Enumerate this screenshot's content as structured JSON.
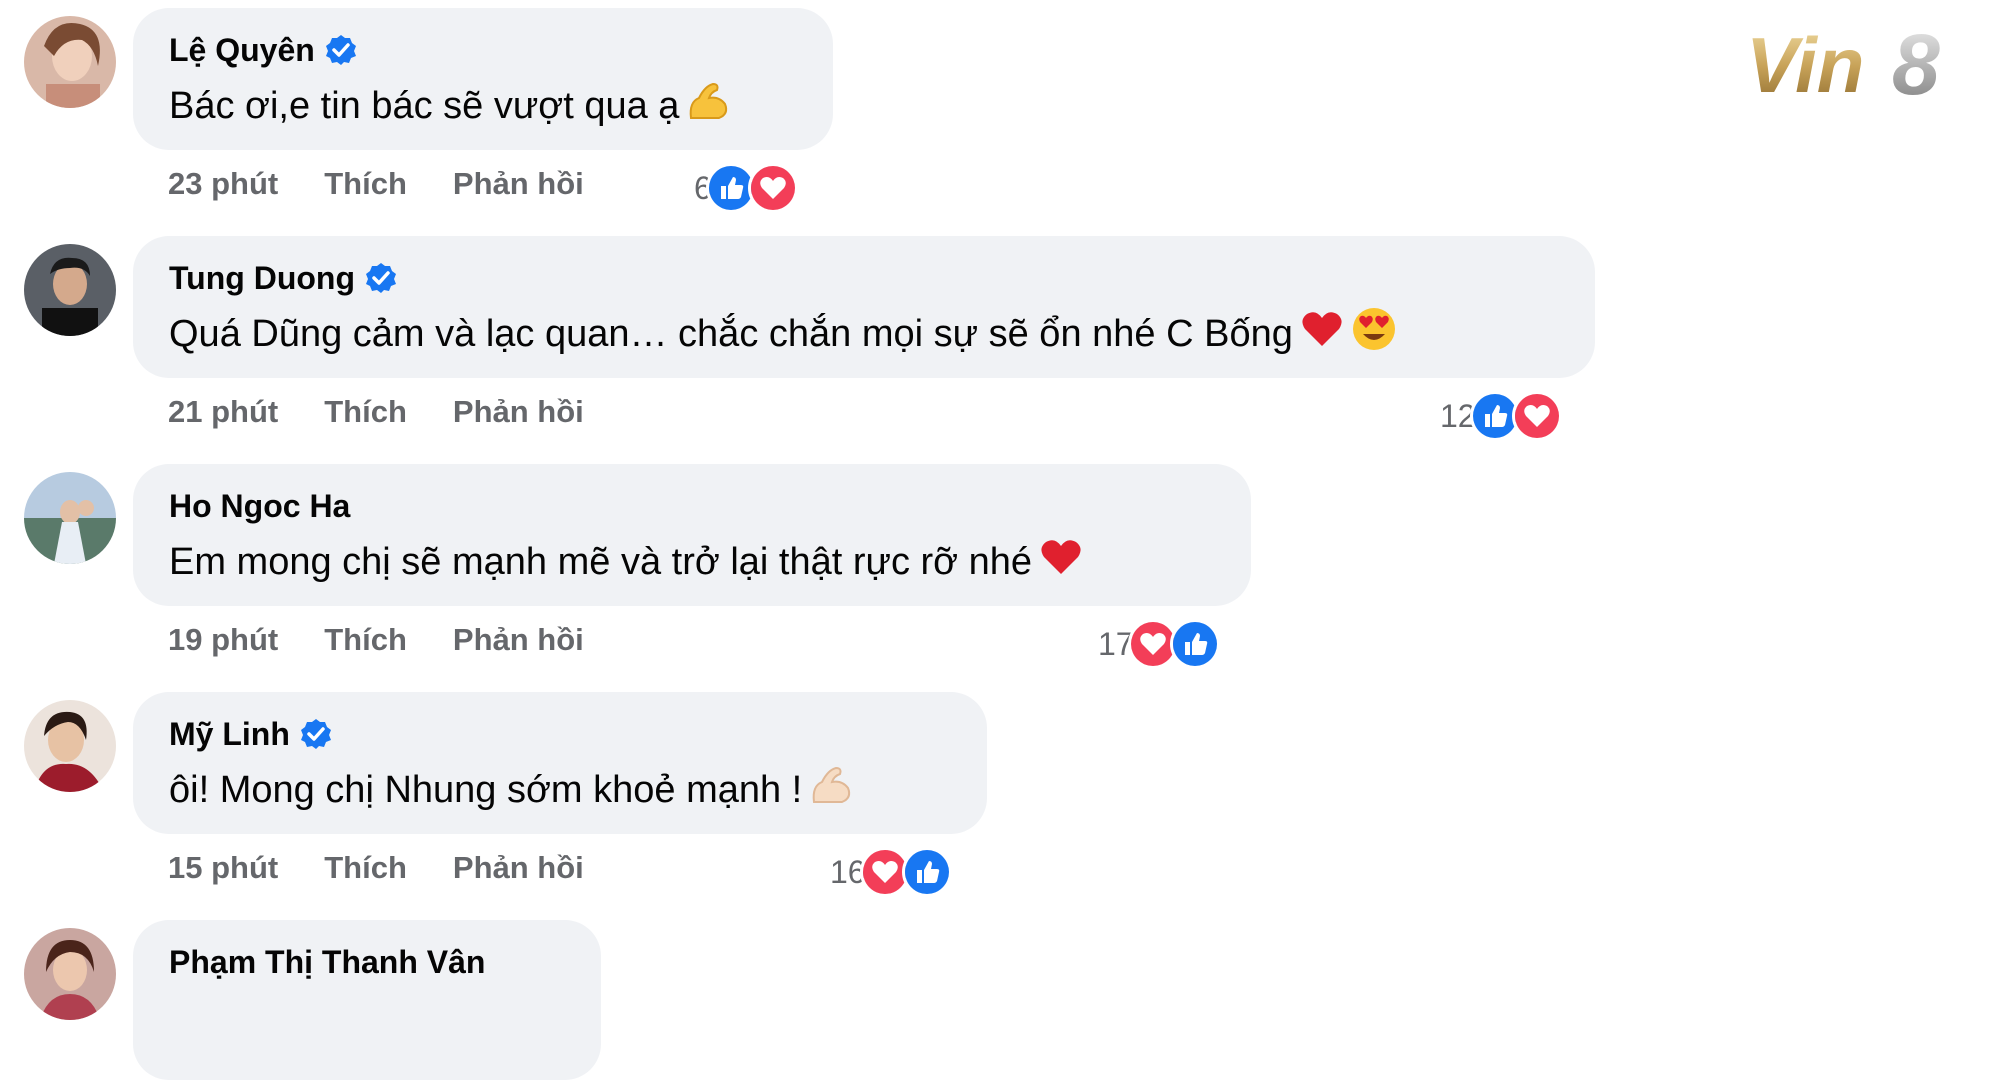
{
  "brand": {
    "logo_text": "Vin8"
  },
  "comments": [
    {
      "name": "Lệ Quyên",
      "verified": true,
      "text": "Bác ơi,e tin bác sẽ vượt qua ạ",
      "emoji": "flexed-biceps",
      "time": "23 phút",
      "like_label": "Thích",
      "reply_label": "Phản hồi",
      "reaction_count": "6",
      "reactions": [
        "like-icon",
        "love-icon"
      ]
    },
    {
      "name": "Tung Duong",
      "verified": true,
      "text": "Quá Dũng cảm và lạc quan… chắc chắn mọi sự sẽ ổn nhé C Bống",
      "emoji": "red-heart, heart-eyes",
      "time": "21 phút",
      "like_label": "Thích",
      "reply_label": "Phản hồi",
      "reaction_count": "12",
      "reactions": [
        "like-icon",
        "love-icon"
      ]
    },
    {
      "name": "Ho Ngoc Ha",
      "verified": false,
      "text": "Em mong chị sẽ mạnh mẽ và trở lại thật rực rỡ nhé",
      "emoji": "red-heart",
      "time": "19 phút",
      "like_label": "Thích",
      "reply_label": "Phản hồi",
      "reaction_count": "17",
      "reactions": [
        "love-icon",
        "like-icon"
      ]
    },
    {
      "name": "Mỹ Linh",
      "verified": true,
      "text": "ôi! Mong chị Nhung sớm khoẻ mạnh !",
      "emoji": "flexed-biceps-light",
      "time": "15 phút",
      "like_label": "Thích",
      "reply_label": "Phản hồi",
      "reaction_count": "16",
      "reactions": [
        "love-icon",
        "like-icon"
      ]
    },
    {
      "name": "Phạm Thị Thanh Vân",
      "verified": false
    }
  ],
  "colors": {
    "bubble": "#f0f2f5",
    "meta_text": "#65676b",
    "verified": "#1877f2",
    "like": "#1877f2",
    "love": "#f33e58",
    "logo_gold": "#c9a45a"
  }
}
